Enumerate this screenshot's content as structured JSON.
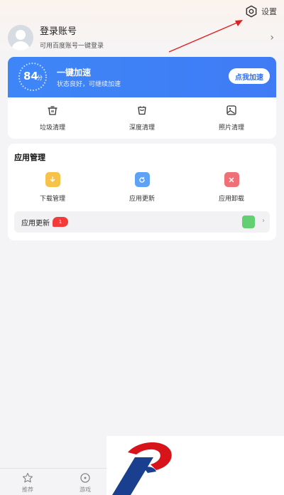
{
  "header": {
    "settings_label": "设置",
    "settings_icon": "gear-icon"
  },
  "account": {
    "title": "登录账号",
    "subtitle": "可用百度账号一键登录",
    "avatar_icon": "avatar-icon"
  },
  "speed": {
    "score": "84",
    "score_unit": "分",
    "title": "一键加速",
    "subtitle": "状态良好，可继续加速",
    "button": "点我加速",
    "accent": "#3e86f7"
  },
  "clean": {
    "items": [
      {
        "label": "垃圾清理",
        "icon": "trash-can-icon"
      },
      {
        "label": "深度清理",
        "icon": "deep-clean-icon"
      },
      {
        "label": "照片清理",
        "icon": "photo-icon"
      }
    ]
  },
  "apps": {
    "title": "应用管理",
    "items": [
      {
        "label": "下载管理",
        "icon": "download-icon",
        "color": "#f7c24a"
      },
      {
        "label": "应用更新",
        "icon": "update-icon",
        "color": "#5ea2f5"
      },
      {
        "label": "应用卸载",
        "icon": "uninstall-icon",
        "color": "#f07078"
      }
    ],
    "update_row": {
      "label": "应用更新",
      "badge": "1",
      "badge_color": "#f33b3b"
    }
  },
  "nav": {
    "items": [
      {
        "label": "推荐",
        "icon": "star-icon"
      },
      {
        "label": "游戏",
        "icon": "game-icon"
      }
    ]
  }
}
